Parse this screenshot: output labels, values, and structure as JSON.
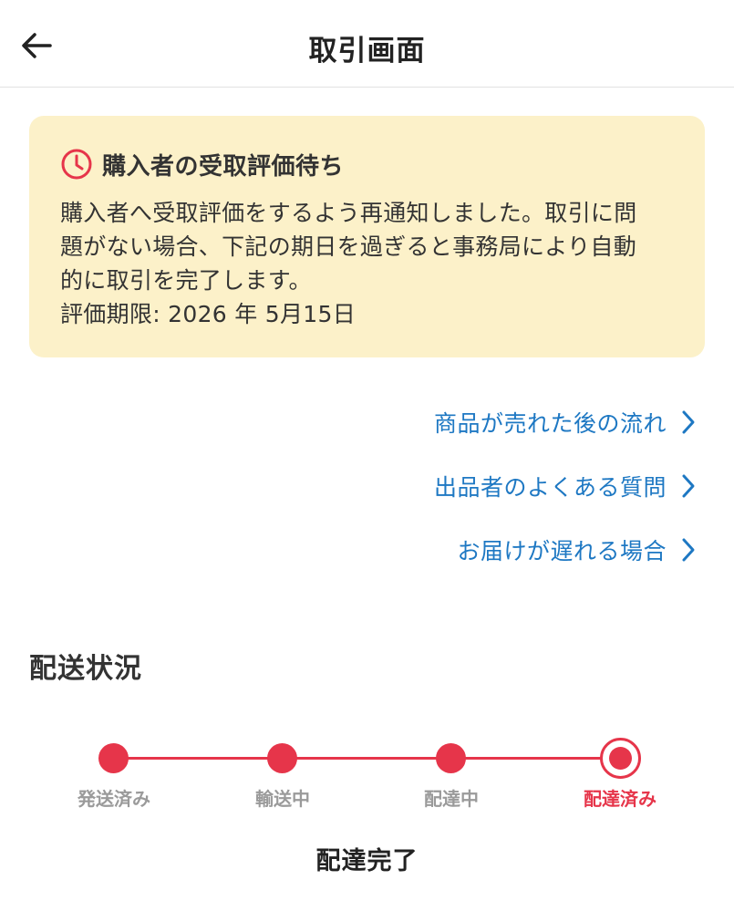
{
  "header": {
    "title": "取引画面",
    "back_icon": "arrow-left-icon"
  },
  "notice": {
    "icon": "clock-icon",
    "title": "購入者の受取評価待ち",
    "body": "購入者へ受取評価をするよう再通知しました。取引に問\n題がない場合、下記の期日を過ぎると事務局により自動\n的に取引を完了します。",
    "deadline": "評価期限: 2026 年 5月15日",
    "background_color": "#fcf1c9"
  },
  "links": [
    {
      "label": "商品が売れた後の流れ"
    },
    {
      "label": "出品者のよくある質問"
    },
    {
      "label": "お届けが遅れる場合"
    }
  ],
  "shipping": {
    "section_title": "配送状況",
    "steps": [
      {
        "label": "発送済み"
      },
      {
        "label": "輸送中"
      },
      {
        "label": "配達中"
      },
      {
        "label": "配達済み"
      }
    ],
    "current_step": 4,
    "status_text": "配達完了",
    "accent_color": "#e6354a"
  },
  "colors": {
    "link": "#1e78c3",
    "accent": "#e6354a",
    "inactive_label": "#9a9a9a"
  }
}
